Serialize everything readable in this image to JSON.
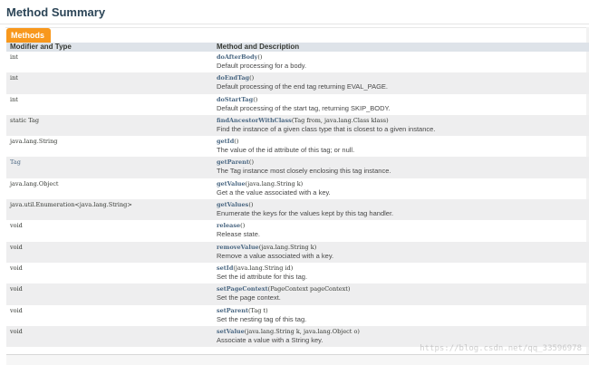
{
  "section": {
    "title": "Method Summary",
    "tab_label": "Methods"
  },
  "table": {
    "headers": {
      "col1": "Modifier and Type",
      "col2": "Method and Description"
    },
    "rows": [
      {
        "type": "int",
        "method": "doAfterBody",
        "params": "()",
        "desc": "Default processing for a body."
      },
      {
        "type": "int",
        "method": "doEndTag",
        "params": "()",
        "desc": "Default processing of the end tag returning EVAL_PAGE."
      },
      {
        "type": "int",
        "method": "doStartTag",
        "params": "()",
        "desc": "Default processing of the start tag, returning SKIP_BODY."
      },
      {
        "type": "static Tag",
        "method": "findAncestorWithClass",
        "params": "(Tag  from,  java.lang.Class  klass)",
        "desc": "Find the instance of a given class type that is closest to a given instance."
      },
      {
        "type": "java.lang.String",
        "method": "getId",
        "params": "()",
        "desc": "The value of the id attribute of this tag; or null."
      },
      {
        "type": "Tag",
        "method": "getParent",
        "params": "()",
        "desc": "The Tag instance most closely enclosing this tag instance."
      },
      {
        "type": "java.lang.Object",
        "method": "getValue",
        "params": "(java.lang.String  k)",
        "desc": "Get a the value associated with a key."
      },
      {
        "type": "java.util.Enumeration<java.lang.String>",
        "method": "getValues",
        "params": "()",
        "desc": "Enumerate the keys for the values kept by this tag handler."
      },
      {
        "type": "void",
        "method": "release",
        "params": "()",
        "desc": "Release state."
      },
      {
        "type": "void",
        "method": "removeValue",
        "params": "(java.lang.String  k)",
        "desc": "Remove a value associated with a key."
      },
      {
        "type": "void",
        "method": "setId",
        "params": "(java.lang.String  id)",
        "desc": "Set the id attribute for this tag."
      },
      {
        "type": "void",
        "method": "setPageContext",
        "params": "(PageContext  pageContext)",
        "desc": "Set the page context."
      },
      {
        "type": "void",
        "method": "setParent",
        "params": "(Tag  t)",
        "desc": "Set the nesting tag of this tag."
      },
      {
        "type": "void",
        "method": "setValue",
        "params": "(java.lang.String  k,  java.lang.Object  o)",
        "desc": "Associate a value with a String key."
      }
    ]
  },
  "watermark": "https://blog.csdn.net/qq_33596978"
}
